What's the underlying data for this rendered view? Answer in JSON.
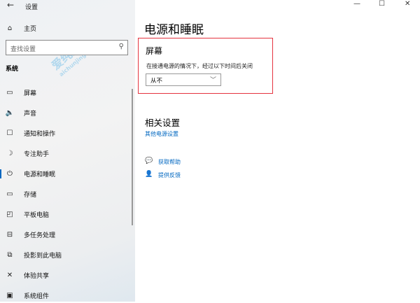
{
  "window": {
    "title": "设置",
    "back": "←",
    "minimize": "—",
    "maximize": "☐",
    "close": "✕"
  },
  "watermark": {
    "text": "爱纯净",
    "url": "aichunjing.com"
  },
  "sidebar": {
    "home": "主页",
    "search_placeholder": "查找设置",
    "section": "系统",
    "items": [
      {
        "label": "屏幕",
        "icon": "▭"
      },
      {
        "label": "声音",
        "icon": "🔈"
      },
      {
        "label": "通知和操作",
        "icon": "☐"
      },
      {
        "label": "专注助手",
        "icon": "☽"
      },
      {
        "label": "电源和睡眠",
        "icon": "⏻"
      },
      {
        "label": "存储",
        "icon": "▭"
      },
      {
        "label": "平板电脑",
        "icon": "◰"
      },
      {
        "label": "多任务处理",
        "icon": "⊟"
      },
      {
        "label": "投影到此电脑",
        "icon": "⧉"
      },
      {
        "label": "体验共享",
        "icon": "✕"
      },
      {
        "label": "系统组件",
        "icon": "▣"
      }
    ],
    "active_index": 4
  },
  "main": {
    "title": "电源和睡眠",
    "screen": {
      "heading": "屏幕",
      "desc": "在接通电源的情况下，经过以下时间后关闭",
      "value": "从不"
    },
    "related": {
      "heading": "相关设置",
      "link": "其他电源设置"
    },
    "help": "获取帮助",
    "feedback": "提供反馈"
  },
  "colors": {
    "accent": "#0067c0",
    "highlight": "#e5333f"
  }
}
